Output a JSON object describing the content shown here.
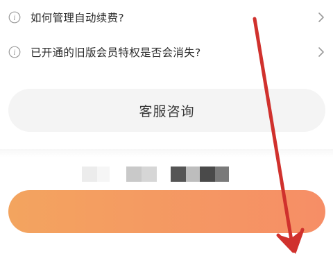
{
  "faq": {
    "items": [
      {
        "label": "如何管理自动续费?"
      },
      {
        "label": "已开通的旧版会员特权是否会消失?"
      }
    ]
  },
  "service": {
    "label": "客服咨询"
  },
  "icons": {
    "info": "info-icon",
    "chevron": "chevron-right-icon"
  },
  "colors": {
    "text": "#2c2c2c",
    "service_button_bg": "#f4f4f4",
    "cta_gradient_start": "#f3a45f",
    "cta_gradient_end": "#f68e66",
    "annotation_arrow": "#d0312d"
  }
}
